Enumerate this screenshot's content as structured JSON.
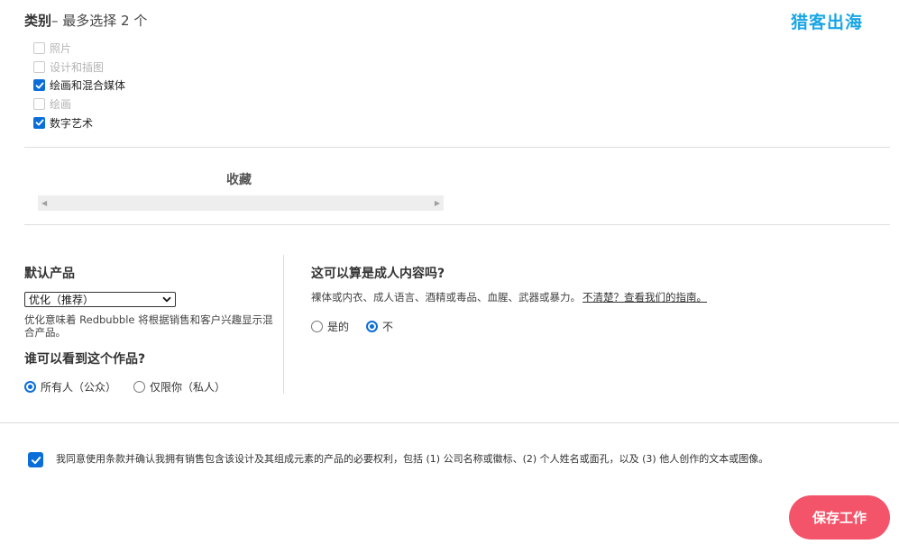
{
  "category": {
    "title": "类别",
    "subtitle": "– 最多选择 2 个",
    "items": [
      {
        "label": "照片",
        "checked": false
      },
      {
        "label": "设计和插图",
        "checked": false
      },
      {
        "label": "绘画和混合媒体",
        "checked": true
      },
      {
        "label": "绘画",
        "checked": false
      },
      {
        "label": "数字艺术",
        "checked": true
      }
    ]
  },
  "brand": {
    "logo_text": "猎客出海",
    "color": "#1aa6e4"
  },
  "collections": {
    "title": "收藏"
  },
  "default_product": {
    "title": "默认产品",
    "selected": "优化（推荐）",
    "helper": "优化意味着 Redbubble 将根据销售和客户兴趣显示混合产品。"
  },
  "visibility": {
    "title": "谁可以看到这个作品?",
    "options": [
      {
        "label": "所有人（公众）",
        "selected": true
      },
      {
        "label": "仅限你（私人）",
        "selected": false
      }
    ]
  },
  "adult": {
    "title": "这可以算是成人内容吗?",
    "description": "裸体或内衣、成人语言、酒精或毒品、血腥、武器或暴力。",
    "link": "不清楚？查看我们的指南。",
    "options": [
      {
        "label": "是的",
        "selected": false
      },
      {
        "label": "不",
        "selected": true
      }
    ]
  },
  "agreement": {
    "checked": true,
    "text": "我同意使用条款并确认我拥有销售包含该设计及其组成元素的产品的必要权利，包括 (1) 公司名称或徽标、(2) 个人姓名或面孔，以及 (3) 他人创作的文本或图像。"
  },
  "actions": {
    "save_label": "保存工作",
    "save_color": "#f4546a"
  },
  "colors": {
    "accent": "#0b6ed8"
  }
}
